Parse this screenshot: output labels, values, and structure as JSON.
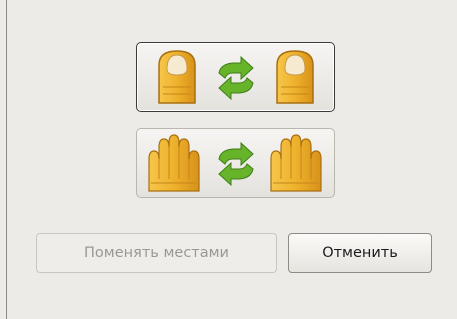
{
  "options": [
    {
      "id": "finger",
      "icon": "finger-swap-icon",
      "selected": true
    },
    {
      "id": "hand",
      "icon": "hand-swap-icon",
      "selected": false
    }
  ],
  "buttons": {
    "swap_label": "Поменять местами",
    "cancel_label": "Отменить"
  },
  "colors": {
    "hand_fill": "#eeb12c",
    "hand_stroke": "#a86f10",
    "arrow_green": "#67b32a",
    "background": "#edebe7"
  }
}
